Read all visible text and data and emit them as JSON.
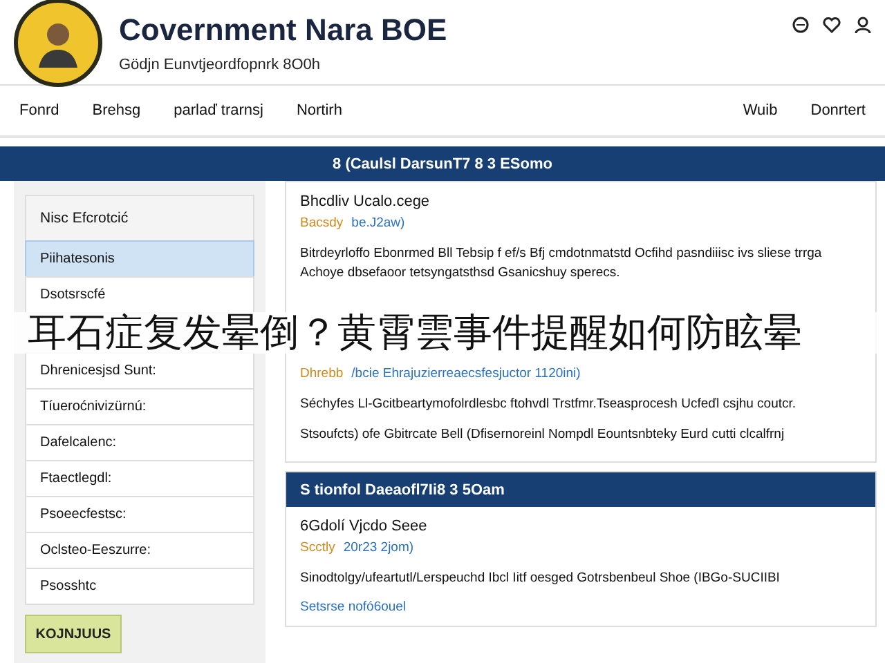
{
  "header": {
    "title": "Covernment Nara BOE",
    "subtitle": "Gödjn Eunvtjeordfopnrk 8O0h"
  },
  "nav": {
    "left": [
      "Fonrd",
      "Brehsg",
      "parlaď trarnsj",
      "Nortirh"
    ],
    "right": [
      "Wuib",
      "Donrtert"
    ]
  },
  "banner": {
    "title": "8 (Caulsl DarsunT7 8 3 ESomo"
  },
  "sidebar": {
    "items": [
      {
        "label": "Nisc Efcrotcić",
        "selected": false,
        "kind": "heading"
      },
      {
        "label": "Piihatesonis",
        "selected": true,
        "kind": "item"
      },
      {
        "label": "Dsotsrscfé",
        "selected": false,
        "kind": "item"
      },
      {
        "label": "Dhrenicesjsd Sunt:",
        "selected": false,
        "kind": "item"
      },
      {
        "label": "Tíueroćnivizürnú:",
        "selected": false,
        "kind": "item"
      },
      {
        "label": "Dafelcalenc:",
        "selected": false,
        "kind": "item"
      },
      {
        "label": "Ftaectlegdl:",
        "selected": false,
        "kind": "item"
      },
      {
        "label": "Psoeecfestsc:",
        "selected": false,
        "kind": "item"
      },
      {
        "label": "Oclsteo-Eeszurre:",
        "selected": false,
        "kind": "item"
      },
      {
        "label": "Psosshtc",
        "selected": false,
        "kind": "item"
      }
    ],
    "button": "KOJNJUUS"
  },
  "cards": [
    {
      "title": "Bhcdliv Ucalo.cege",
      "source": "Bacsdy",
      "date": "be.J2aw)",
      "blocks": [
        {
          "kind": "text",
          "text": "Bitrdeyrloffo Ebonrmed Bll Tebsip f ef/s Bfj cmdotnmatstd Ocfihd pasndiiisc ivs sliese trrga Achoye dbsefaoor tetsyngatsthsd Gsanicshuy sperecs."
        },
        {
          "kind": "meta",
          "source": "Dhrebb",
          "text": "/bcie Ehrajuzierreaecsfesjuctor 1120ini)"
        },
        {
          "kind": "text",
          "text": "Séchyfes Ll-Gcitbeartymofolrdlesbc ftohvdl Trstfmr.Tseasprocesh Ucfeďl csjhu coutcr."
        },
        {
          "kind": "text",
          "text": "Stsoufcts) ofe Gbitrcate Bell (Dfisernoreinl Nompdl Eountsnbteky Eurd cutti clcalfrnj"
        }
      ]
    },
    {
      "header": "S tionfol Daeaofl7Ii8 3 5Oam",
      "title": "6Gdolí Vjcdo Seee",
      "source": "Scctly",
      "date": "20r23 2jom)",
      "blocks": [
        {
          "kind": "text",
          "text": "Sinodtolgy/ufeartutl/Lerspeuchd Ibcl Iitf oesged Gotrsbenbeul Shoe (IBGo-SUCIIBI"
        },
        {
          "kind": "link",
          "text": "Setsrse nofó6ouel"
        }
      ]
    }
  ],
  "caption": "耳石症复发晕倒？黄霄雲事件提醒如何防眩晕"
}
